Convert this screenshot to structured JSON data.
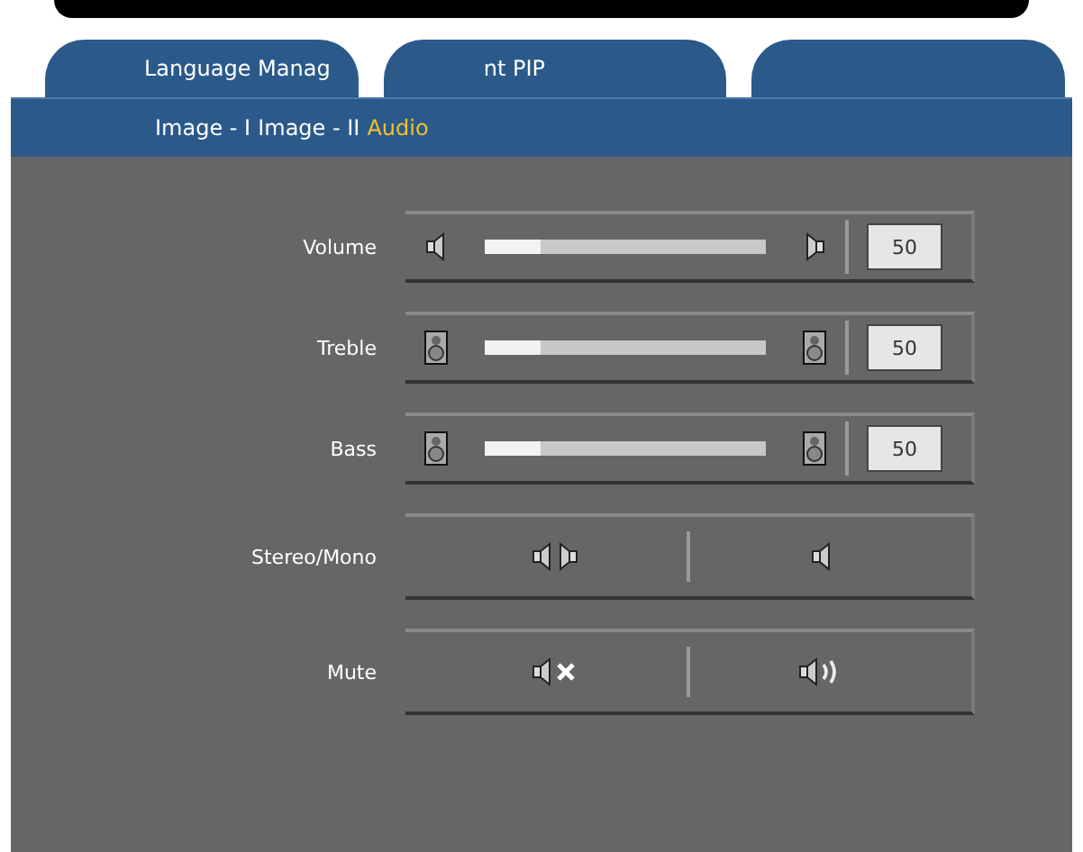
{
  "top_tabs": [
    {
      "label": "Language Manag",
      "selected": false
    },
    {
      "label": "nt PIP",
      "selected": false
    }
  ],
  "sub_tabs": [
    {
      "label": "Image - I",
      "selected": false
    },
    {
      "label": "Image - II",
      "selected": false
    },
    {
      "label": "Audio",
      "selected": true
    }
  ],
  "rows": [
    {
      "kind": "slider",
      "label": "Volume",
      "level": 0.2,
      "value": "50"
    },
    {
      "kind": "slider",
      "label": "Treble",
      "level": 0.2,
      "value": "50"
    },
    {
      "kind": "slider",
      "label": "Bass",
      "level": 0.2,
      "value": "50"
    },
    {
      "kind": "choice",
      "label": "Stereo/Mono"
    },
    {
      "kind": "choice",
      "label": "Mute"
    }
  ]
}
